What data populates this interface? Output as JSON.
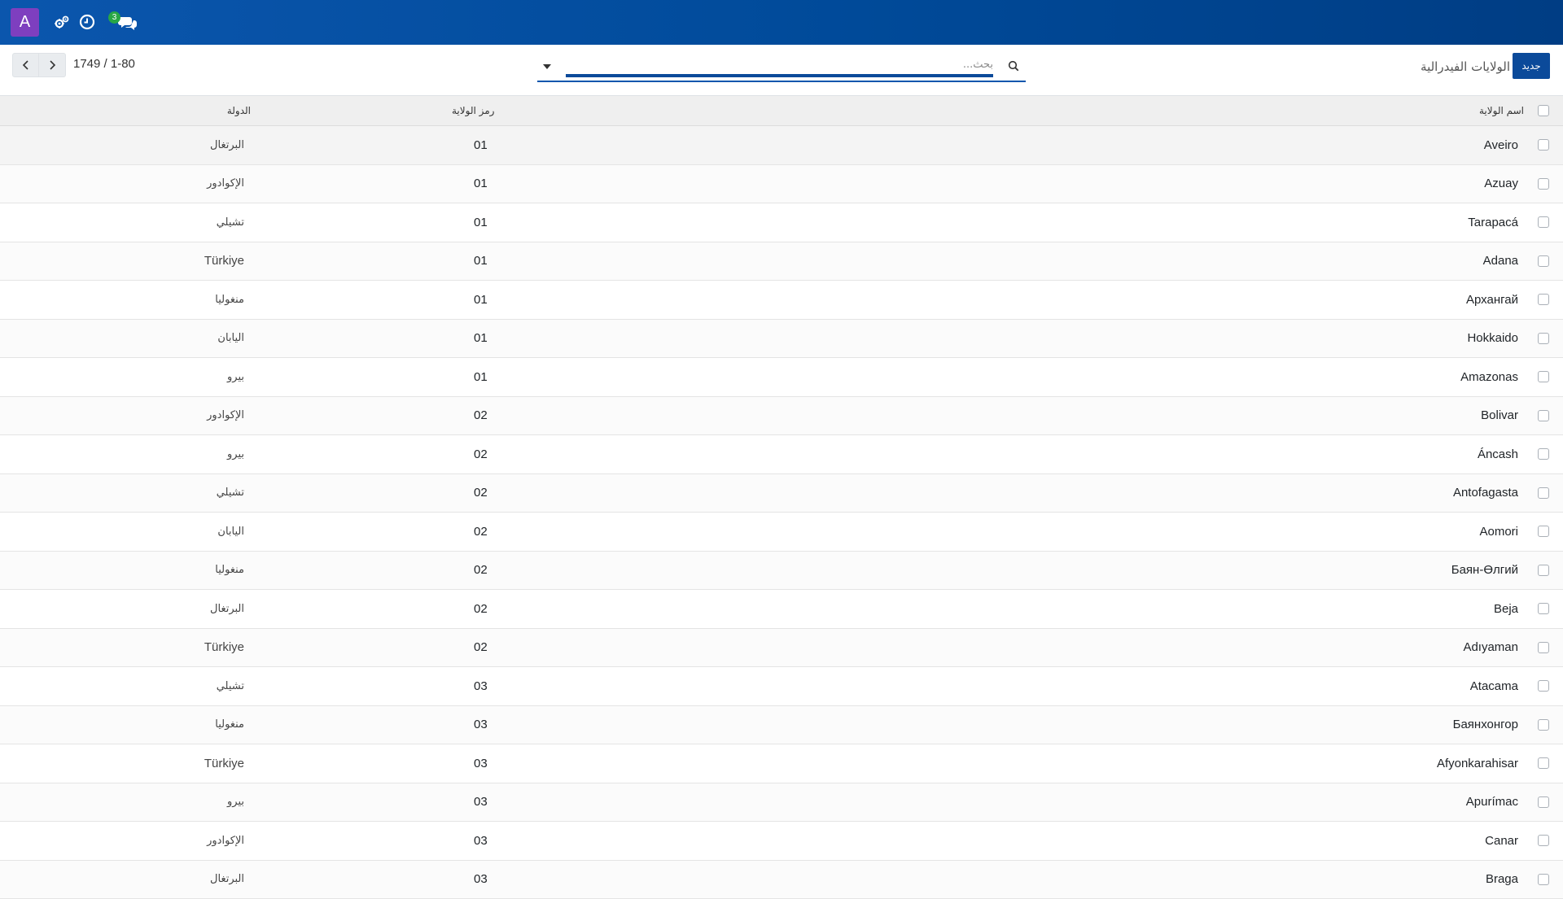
{
  "navbar": {
    "avatar_letter": "A",
    "icons": [
      "settings-gears-icon",
      "clock-icon",
      "chat-icon"
    ],
    "chat_badge": "3",
    "colors": {
      "bar": "#0b56ad",
      "avatar": "#7e3fbf",
      "badge": "#28a745"
    }
  },
  "control_panel": {
    "pager_text": "1749 / 1-80",
    "search_placeholder": "بحث...",
    "breadcrumb": "الولايات الفيدرالية",
    "new_label": "جديد"
  },
  "table": {
    "columns": {
      "name": "اسم الولاية",
      "code": "رمز الولاية",
      "country": "الدولة"
    },
    "rows": [
      {
        "name": "Aveiro",
        "code": "01",
        "country": "البرتغال"
      },
      {
        "name": "Azuay",
        "code": "01",
        "country": "الإكوادور"
      },
      {
        "name": "Tarapacá",
        "code": "01",
        "country": "تشيلي"
      },
      {
        "name": "Adana",
        "code": "01",
        "country": "Türkiye"
      },
      {
        "name": "Архангай",
        "code": "01",
        "country": "منغوليا"
      },
      {
        "name": "Hokkaido",
        "code": "01",
        "country": "اليابان"
      },
      {
        "name": "Amazonas",
        "code": "01",
        "country": "بيرو"
      },
      {
        "name": "Bolivar",
        "code": "02",
        "country": "الإكوادور"
      },
      {
        "name": "Áncash",
        "code": "02",
        "country": "بيرو"
      },
      {
        "name": "Antofagasta",
        "code": "02",
        "country": "تشيلي"
      },
      {
        "name": "Aomori",
        "code": "02",
        "country": "اليابان"
      },
      {
        "name": "Баян-Өлгий",
        "code": "02",
        "country": "منغوليا"
      },
      {
        "name": "Beja",
        "code": "02",
        "country": "البرتغال"
      },
      {
        "name": "Adıyaman",
        "code": "02",
        "country": "Türkiye"
      },
      {
        "name": "Atacama",
        "code": "03",
        "country": "تشيلي"
      },
      {
        "name": "Баянхонгор",
        "code": "03",
        "country": "منغوليا"
      },
      {
        "name": "Afyonkarahisar",
        "code": "03",
        "country": "Türkiye"
      },
      {
        "name": "Apurímac",
        "code": "03",
        "country": "بيرو"
      },
      {
        "name": "Canar",
        "code": "03",
        "country": "الإكوادور"
      },
      {
        "name": "Braga",
        "code": "03",
        "country": "البرتغال"
      }
    ]
  }
}
